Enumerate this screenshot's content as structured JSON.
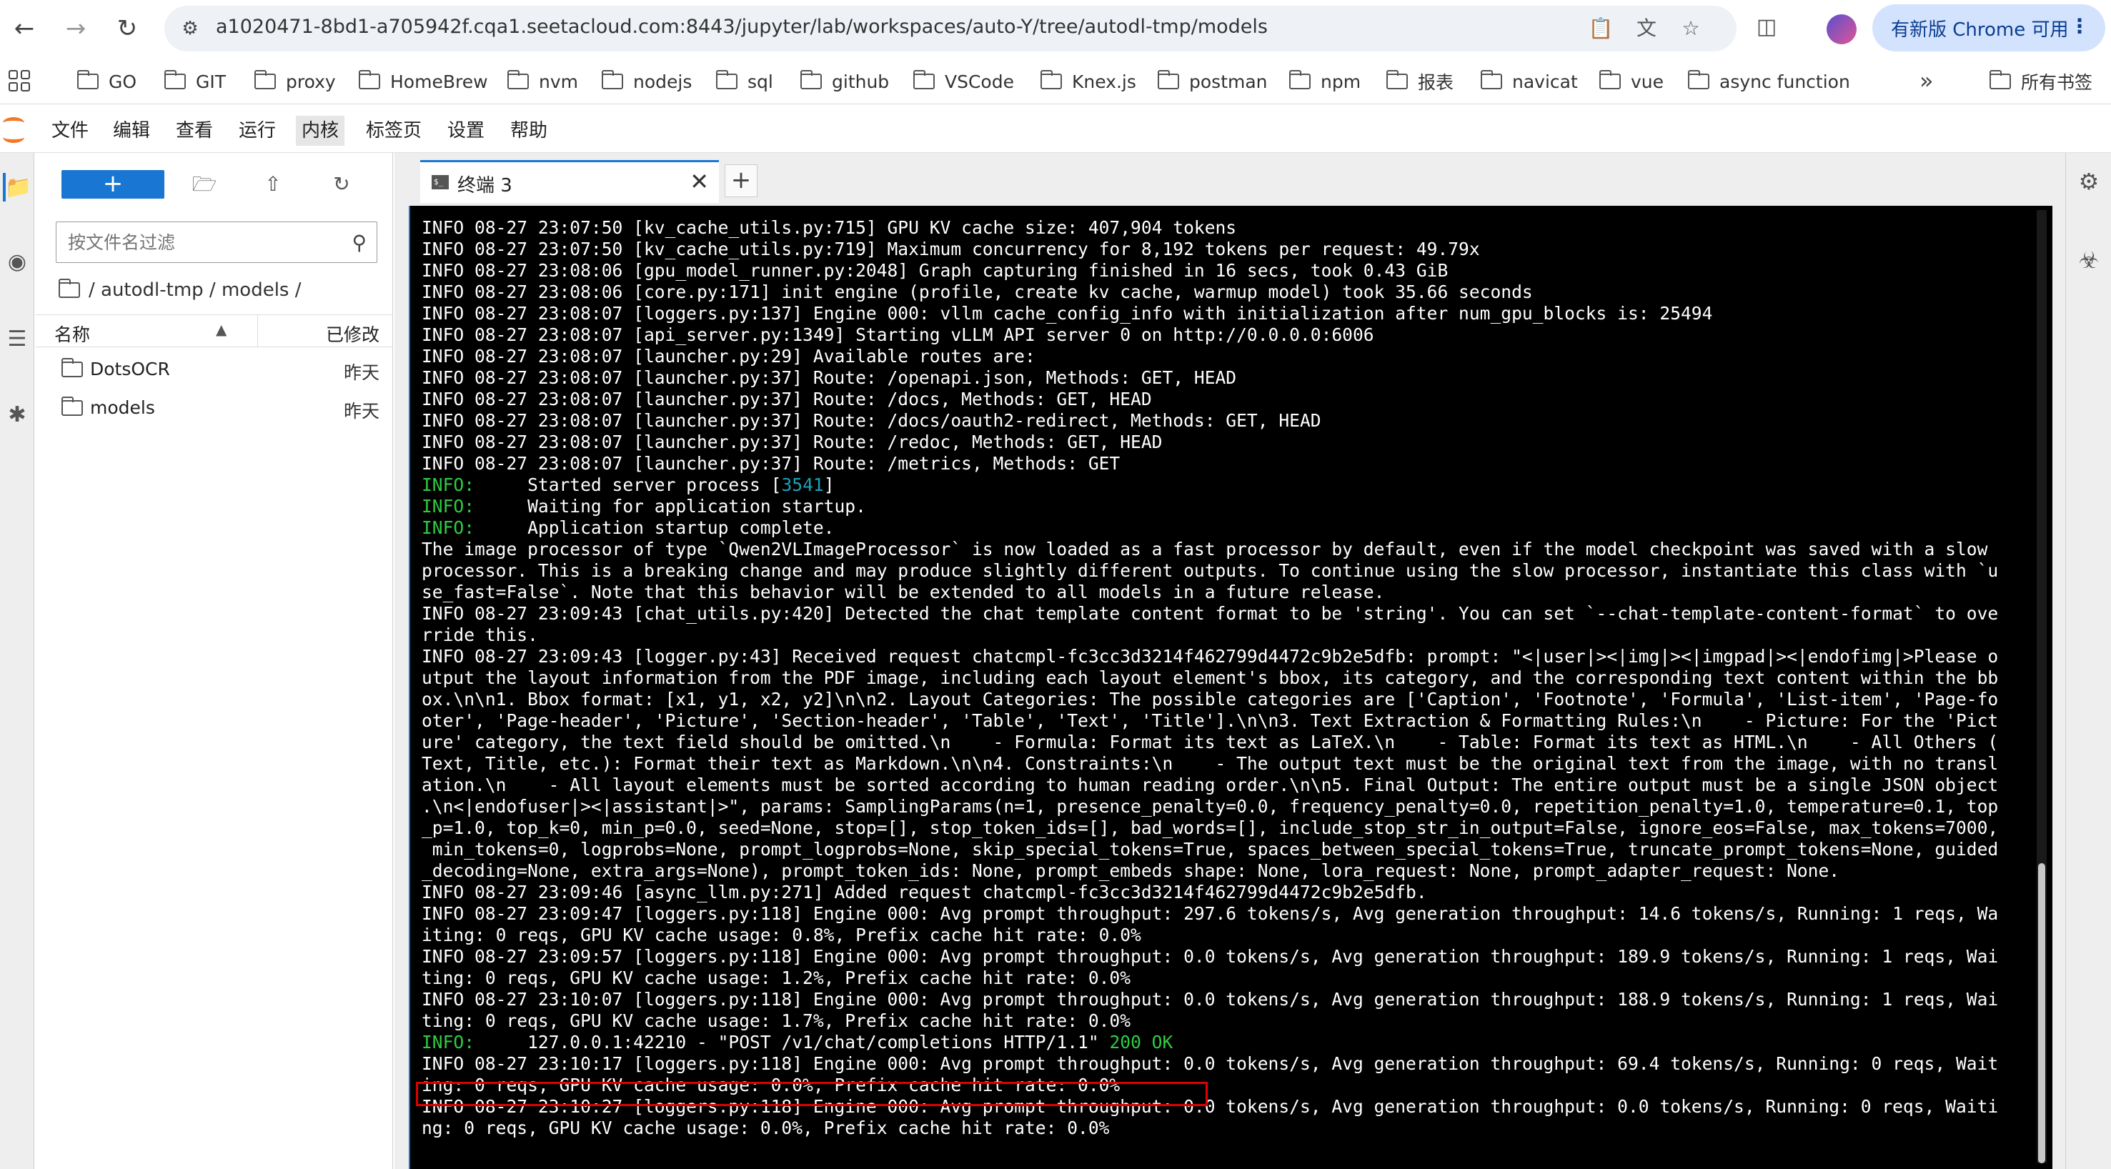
{
  "browser": {
    "url": "a1020471-8bd1-a705942f.cqa1.seetacloud.com:8443/jupyter/lab/workspaces/auto-Y/tree/autodl-tmp/models",
    "update_label": "有新版 Chrome 可用",
    "bookmarks": [
      {
        "label": "GO"
      },
      {
        "label": "GIT"
      },
      {
        "label": "proxy"
      },
      {
        "label": "HomeBrew"
      },
      {
        "label": "nvm"
      },
      {
        "label": "nodejs"
      },
      {
        "label": "sql"
      },
      {
        "label": "github"
      },
      {
        "label": "VSCode"
      },
      {
        "label": "Knex.js"
      },
      {
        "label": "postman"
      },
      {
        "label": "npm"
      },
      {
        "label": "报表"
      },
      {
        "label": "navicat"
      },
      {
        "label": "vue"
      },
      {
        "label": "async function"
      }
    ],
    "all_bookmarks_label": "所有书签"
  },
  "menu": {
    "items": [
      "文件",
      "编辑",
      "查看",
      "运行",
      "内核",
      "标签页",
      "设置",
      "帮助"
    ]
  },
  "filebrowser": {
    "filter_placeholder": "按文件名过滤",
    "breadcrumb": "/ autodl-tmp / models /",
    "col_name": "名称",
    "col_modified": "已修改",
    "files": [
      {
        "name": "DotsOCR",
        "modified": "昨天"
      },
      {
        "name": "models",
        "modified": "昨天"
      }
    ]
  },
  "tab": {
    "label": "终端 3"
  },
  "terminal": {
    "lines": [
      {
        "segs": [
          {
            "t": "INFO 08-27 23:07:50 [kv_cache_utils.py:715] GPU KV cache size: 407,904 tokens"
          }
        ]
      },
      {
        "segs": [
          {
            "t": "INFO 08-27 23:07:50 [kv_cache_utils.py:719] Maximum concurrency for 8,192 tokens per request: 49.79x"
          }
        ]
      },
      {
        "segs": [
          {
            "t": "INFO 08-27 23:08:06 [gpu_model_runner.py:2048] Graph capturing finished in 16 secs, took 0.43 GiB"
          }
        ]
      },
      {
        "segs": [
          {
            "t": "INFO 08-27 23:08:06 [core.py:171] init engine (profile, create kv cache, warmup model) took 35.66 seconds"
          }
        ]
      },
      {
        "segs": [
          {
            "t": "INFO 08-27 23:08:07 [loggers.py:137] Engine 000: vllm cache_config_info with initialization after num_gpu_blocks is: 25494"
          }
        ]
      },
      {
        "segs": [
          {
            "t": "INFO 08-27 23:08:07 [api_server.py:1349] Starting vLLM API server 0 on http://0.0.0.0:6006"
          }
        ]
      },
      {
        "segs": [
          {
            "t": "INFO 08-27 23:08:07 [launcher.py:29] Available routes are:"
          }
        ]
      },
      {
        "segs": [
          {
            "t": "INFO 08-27 23:08:07 [launcher.py:37] Route: /openapi.json, Methods: GET, HEAD"
          }
        ]
      },
      {
        "segs": [
          {
            "t": "INFO 08-27 23:08:07 [launcher.py:37] Route: /docs, Methods: GET, HEAD"
          }
        ]
      },
      {
        "segs": [
          {
            "t": "INFO 08-27 23:08:07 [launcher.py:37] Route: /docs/oauth2-redirect, Methods: GET, HEAD"
          }
        ]
      },
      {
        "segs": [
          {
            "t": "INFO 08-27 23:08:07 [launcher.py:37] Route: /redoc, Methods: GET, HEAD"
          }
        ]
      },
      {
        "segs": [
          {
            "t": "INFO 08-27 23:08:07 [launcher.py:37] Route: /metrics, Methods: GET"
          }
        ]
      },
      {
        "segs": [
          {
            "t": "INFO:",
            "c": "g"
          },
          {
            "t": "     Started server process ["
          },
          {
            "t": "3541",
            "c": "cy"
          },
          {
            "t": "]"
          }
        ]
      },
      {
        "segs": [
          {
            "t": "INFO:",
            "c": "g"
          },
          {
            "t": "     Waiting for application startup."
          }
        ]
      },
      {
        "segs": [
          {
            "t": "INFO:",
            "c": "g"
          },
          {
            "t": "     Application startup complete."
          }
        ]
      },
      {
        "segs": [
          {
            "t": "The image processor of type `Qwen2VLImageProcessor` is now loaded as a fast processor by default, even if the model checkpoint was saved with a slow"
          }
        ]
      },
      {
        "segs": [
          {
            "t": "processor. This is a breaking change and may produce slightly different outputs. To continue using the slow processor, instantiate this class with `u"
          }
        ]
      },
      {
        "segs": [
          {
            "t": "se_fast=False`. Note that this behavior will be extended to all models in a future release."
          }
        ]
      },
      {
        "segs": [
          {
            "t": "INFO 08-27 23:09:43 [chat_utils.py:420] Detected the chat template content format to be 'string'. You can set `--chat-template-content-format` to ove"
          }
        ]
      },
      {
        "segs": [
          {
            "t": "rride this."
          }
        ]
      },
      {
        "segs": [
          {
            "t": "INFO 08-27 23:09:43 [logger.py:43] Received request chatcmpl-fc3cc3d3214f462799d4472c9b2e5dfb: prompt: \"<|user|><|img|><|imgpad|><|endofimg|>Please o"
          }
        ]
      },
      {
        "segs": [
          {
            "t": "utput the layout information from the PDF image, including each layout element's bbox, its category, and the corresponding text content within the bb"
          }
        ]
      },
      {
        "segs": [
          {
            "t": "ox.\\n\\n1. Bbox format: [x1, y1, x2, y2]\\n\\n2. Layout Categories: The possible categories are ['Caption', 'Footnote', 'Formula', 'List-item', 'Page-fo"
          }
        ]
      },
      {
        "segs": [
          {
            "t": "oter', 'Page-header', 'Picture', 'Section-header', 'Table', 'Text', 'Title'].\\n\\n3. Text Extraction & Formatting Rules:\\n    - Picture: For the 'Pict"
          }
        ]
      },
      {
        "segs": [
          {
            "t": "ure' category, the text field should be omitted.\\n    - Formula: Format its text as LaTeX.\\n    - Table: Format its text as HTML.\\n    - All Others ("
          }
        ]
      },
      {
        "segs": [
          {
            "t": "Text, Title, etc.): Format their text as Markdown.\\n\\n4. Constraints:\\n    - The output text must be the original text from the image, with no transl"
          }
        ]
      },
      {
        "segs": [
          {
            "t": "ation.\\n    - All layout elements must be sorted according to human reading order.\\n\\n5. Final Output: The entire output must be a single JSON object"
          }
        ]
      },
      {
        "segs": [
          {
            "t": ".\\n<|endofuser|><|assistant|>\", params: SamplingParams(n=1, presence_penalty=0.0, frequency_penalty=0.0, repetition_penalty=1.0, temperature=0.1, top"
          }
        ]
      },
      {
        "segs": [
          {
            "t": "_p=1.0, top_k=0, min_p=0.0, seed=None, stop=[], stop_token_ids=[], bad_words=[], include_stop_str_in_output=False, ignore_eos=False, max_tokens=7000,"
          }
        ]
      },
      {
        "segs": [
          {
            "t": " min_tokens=0, logprobs=None, prompt_logprobs=None, skip_special_tokens=True, spaces_between_special_tokens=True, truncate_prompt_tokens=None, guided"
          }
        ]
      },
      {
        "segs": [
          {
            "t": "_decoding=None, extra_args=None), prompt_token_ids: None, prompt_embeds shape: None, lora_request: None, prompt_adapter_request: None."
          }
        ]
      },
      {
        "segs": [
          {
            "t": "INFO 08-27 23:09:46 [async_llm.py:271] Added request chatcmpl-fc3cc3d3214f462799d4472c9b2e5dfb."
          }
        ]
      },
      {
        "segs": [
          {
            "t": "INFO 08-27 23:09:47 [loggers.py:118] Engine 000: Avg prompt throughput: 297.6 tokens/s, Avg generation throughput: 14.6 tokens/s, Running: 1 reqs, Wa"
          }
        ]
      },
      {
        "segs": [
          {
            "t": "iting: 0 reqs, GPU KV cache usage: 0.8%, Prefix cache hit rate: 0.0%"
          }
        ]
      },
      {
        "segs": [
          {
            "t": "INFO 08-27 23:09:57 [loggers.py:118] Engine 000: Avg prompt throughput: 0.0 tokens/s, Avg generation throughput: 189.9 tokens/s, Running: 1 reqs, Wai"
          }
        ]
      },
      {
        "segs": [
          {
            "t": "ting: 0 reqs, GPU KV cache usage: 1.2%, Prefix cache hit rate: 0.0%"
          }
        ]
      },
      {
        "segs": [
          {
            "t": "INFO 08-27 23:10:07 [loggers.py:118] Engine 000: Avg prompt throughput: 0.0 tokens/s, Avg generation throughput: 188.9 tokens/s, Running: 1 reqs, Wai"
          }
        ]
      },
      {
        "segs": [
          {
            "t": "ting: 0 reqs, GPU KV cache usage: 1.7%, Prefix cache hit rate: 0.0%"
          }
        ]
      },
      {
        "segs": [
          {
            "t": "INFO:",
            "c": "g"
          },
          {
            "t": "     127.0.0.1:42210 - \"POST /v1/chat/completions HTTP/1.1\" "
          },
          {
            "t": "200 OK",
            "c": "g"
          }
        ]
      },
      {
        "segs": [
          {
            "t": "INFO 08-27 23:10:17 [loggers.py:118] Engine 000: Avg prompt throughput: 0.0 tokens/s, Avg generation throughput: 69.4 tokens/s, Running: 0 reqs, Wait"
          }
        ]
      },
      {
        "segs": [
          {
            "t": "ing: 0 reqs, GPU KV cache usage: 0.0%, Prefix cache hit rate: 0.0%"
          }
        ]
      },
      {
        "segs": [
          {
            "t": "INFO 08-27 23:10:27 [loggers.py:118] Engine 000: Avg prompt throughput: 0.0 tokens/s, Avg generation throughput: 0.0 tokens/s, Running: 0 reqs, Waiti"
          }
        ]
      },
      {
        "segs": [
          {
            "t": "ng: 0 reqs, GPU KV cache usage: 0.0%, Prefix cache hit rate: 0.0%"
          }
        ]
      }
    ]
  },
  "colors": {
    "accent": "#1976d2",
    "terminal_bg": "#000000",
    "terminal_green": "#2ecc40",
    "terminal_cyan": "#17a2b8",
    "highlight_red": "#e00000",
    "jupyter_orange": "#f37726"
  },
  "icons": {
    "back": "arrow-left-icon",
    "forward": "arrow-right-icon",
    "reload": "reload-icon",
    "folder": "folder-icon",
    "search": "search-icon"
  }
}
